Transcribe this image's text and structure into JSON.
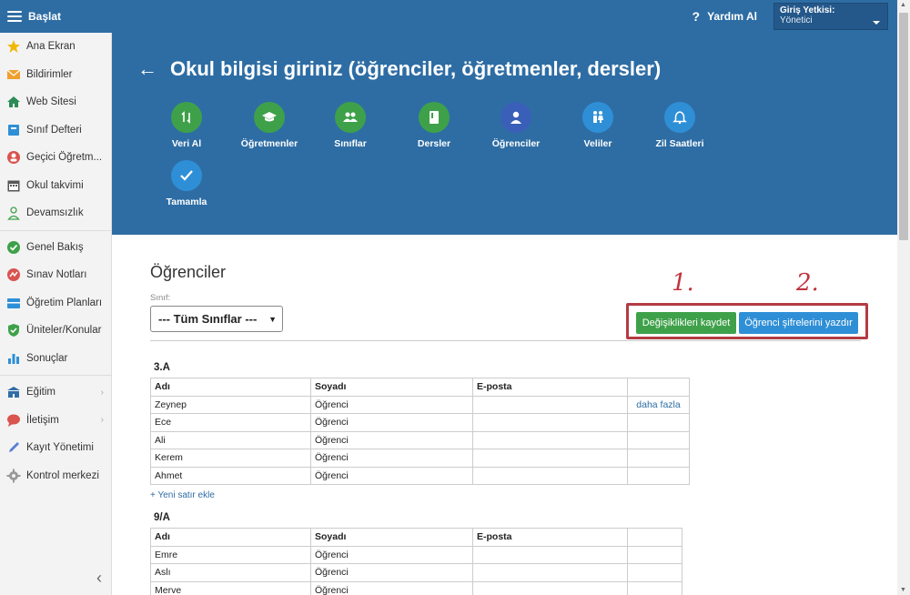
{
  "topbar": {
    "menu_label": "Başlat",
    "help_label": "Yardım Al",
    "help_glyph": "?",
    "role_label": "Giriş Yetkisi:",
    "role_value": "Yönetici"
  },
  "sidebar": {
    "items": [
      {
        "label": "Ana Ekran",
        "icon": "star-icon",
        "color": "#f2b705"
      },
      {
        "label": "Bildirimler",
        "icon": "envelope-icon",
        "color": "#f0a030"
      },
      {
        "label": "Web Sitesi",
        "icon": "home-icon",
        "color": "#2e8b57"
      },
      {
        "label": "Sınıf Defteri",
        "icon": "notebook-icon",
        "color": "#2f8fd6"
      },
      {
        "label": "Geçici Öğretm...",
        "icon": "substitute-teacher-icon",
        "color": "#d9534f"
      },
      {
        "label": "Okul takvimi",
        "icon": "calendar-icon",
        "color": "#555555"
      },
      {
        "label": "Devamsızlık",
        "icon": "person-outline-icon",
        "color": "#3ea14a"
      },
      {
        "label": "Genel Bakış",
        "icon": "check-circle-icon",
        "color": "#3ea14a"
      },
      {
        "label": "Sınav Notları",
        "icon": "grades-icon",
        "color": "#d9534f"
      },
      {
        "label": "Öğretim Planları",
        "icon": "plans-icon",
        "color": "#2f8fd6"
      },
      {
        "label": "Üniteler/Konular",
        "icon": "shield-check-icon",
        "color": "#3ea14a"
      },
      {
        "label": "Sonuçlar",
        "icon": "bar-chart-icon",
        "color": "#2f8fd6"
      },
      {
        "label": "Eğitim",
        "icon": "school-icon",
        "color": "#2f6da4"
      },
      {
        "label": "İletişim",
        "icon": "chat-icon",
        "color": "#d9534f"
      },
      {
        "label": "Kayıt Yönetimi",
        "icon": "pen-icon",
        "color": "#5b7fd6"
      },
      {
        "label": "Kontrol merkezi",
        "icon": "gear-icon",
        "color": "#999999"
      }
    ],
    "collapse_glyph": "‹"
  },
  "header": {
    "back_glyph": "←",
    "title": "Okul bilgisi giriniz (öğrenciler, öğretmenler, dersler)",
    "steps": [
      {
        "label": "Veri Al",
        "icon": "import-arrows-icon",
        "color": "#3ea14a"
      },
      {
        "label": "Öğretmenler",
        "icon": "graduation-cap-icon",
        "color": "#3ea14a"
      },
      {
        "label": "Sınıflar",
        "icon": "group-icon",
        "color": "#3ea14a"
      },
      {
        "label": "Dersler",
        "icon": "book-icon",
        "color": "#3ea14a"
      },
      {
        "label": "Öğrenciler",
        "icon": "person-icon",
        "color": "#3a5fb8"
      },
      {
        "label": "Veliler",
        "icon": "parents-icon",
        "color": "#2f8fd6"
      },
      {
        "label": "Zil Saatleri",
        "icon": "bell-icon",
        "color": "#2f8fd6"
      },
      {
        "label": "Tamamla",
        "icon": "check-icon",
        "color": "#2f8fd6"
      }
    ]
  },
  "main": {
    "section_title": "Öğrenciler",
    "class_filter_label": "Sınıf:",
    "class_filter_value": "--- Tüm Sınıflar ---",
    "save_button": "Değişiklikleri kaydet",
    "print_button": "Öğrenci şifrelerini yazdır",
    "annotation_1": "1.",
    "annotation_2": "2.",
    "add_row_link": "+ Yeni satır ekle",
    "columns": [
      "Adı",
      "Soyadı",
      "E-posta",
      ""
    ],
    "groups": [
      {
        "name": "3.A",
        "rows": [
          [
            "Zeynep",
            "Öğrenci",
            "",
            "daha fazla"
          ],
          [
            "Ece",
            "Öğrenci",
            "",
            ""
          ],
          [
            "Ali",
            "Öğrenci",
            "",
            ""
          ],
          [
            "Kerem",
            "Öğrenci",
            "",
            ""
          ],
          [
            "Ahmet",
            "Öğrenci",
            "",
            ""
          ]
        ]
      },
      {
        "name": "9/A",
        "rows": [
          [
            "Emre",
            "Öğrenci",
            "",
            ""
          ],
          [
            "Aslı",
            "Öğrenci",
            "",
            ""
          ],
          [
            "Merve",
            "Öğrenci",
            "",
            ""
          ]
        ]
      }
    ]
  }
}
